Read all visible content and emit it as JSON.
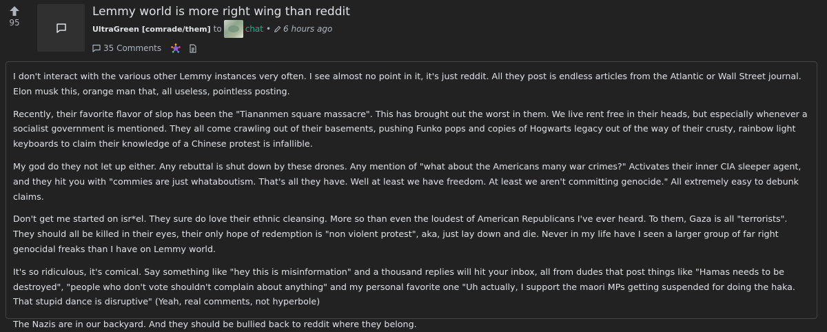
{
  "post": {
    "score": "95",
    "title": "Lemmy world is more right wing than reddit",
    "author": "UltraGreen [comrade/them]",
    "to_word": "to",
    "community": "chat",
    "separator": "•",
    "time": "6 hours ago",
    "comments_label": "35 Comments",
    "thumbnail_icon": "message-square-icon",
    "body": [
      "I don't interact with the various other Lemmy instances very often. I see almost no point in it, it's just reddit. All they post is endless articles from the Atlantic or Wall Street journal. Elon musk this, orange man that, all useless, pointless posting.",
      "Recently, their favorite flavor of slop has been the \"Tiananmen square massacre\". This has brought out the worst in them. We live rent free in their heads, but especially whenever a socialist government is mentioned. They all come crawling out of their basements, pushing Funko pops and copies of Hogwarts legacy out of the way of their crusty, rainbow light keyboards to claim their knowledge of a Chinese protest is infallible.",
      "My god do they not let up either. Any rebuttal is shut down by these drones. Any mention of \"what about the Americans many war crimes?\" Activates their inner CIA sleeper agent, and they hit you with \"commies are just whataboutism. That's all they have. Well at least we have freedom. At least we aren't committing genocide.\" All extremely easy to debunk claims.",
      "Don't get me started on isr*el. They sure do love their ethnic cleansing. More so than even the loudest of American Republicans I've ever heard. To them, Gaza is all \"terrorists\". They should all be killed in their eyes, their only hope of redemption is \"non violent protest\", aka, just lay down and die. Never in my life have I seen a larger group of far right genocidal freaks than I have on Lemmy world.",
      "It's so ridiculous, it's comical. Say something like \"hey this is misinformation\" and a thousand replies will hit your inbox, all from dudes that post things like \"Hamas needs to be destroyed\", \"people who don't vote shouldn't complain about anything\" and my personal favorite one \"Uh actually, I support the maori MPs getting suspended for doing the haka. That stupid dance is disruptive\" (Yeah, real comments, not hyperbole)",
      "The Nazis are in our backyard. And they should be bullied back to reddit where they belong."
    ]
  },
  "colors": {
    "background": "#222222",
    "text": "#dee2e6",
    "muted": "#adb5bd",
    "accent": "#00bc8c",
    "thumbnail_bg": "#303030",
    "border": "#444444"
  }
}
